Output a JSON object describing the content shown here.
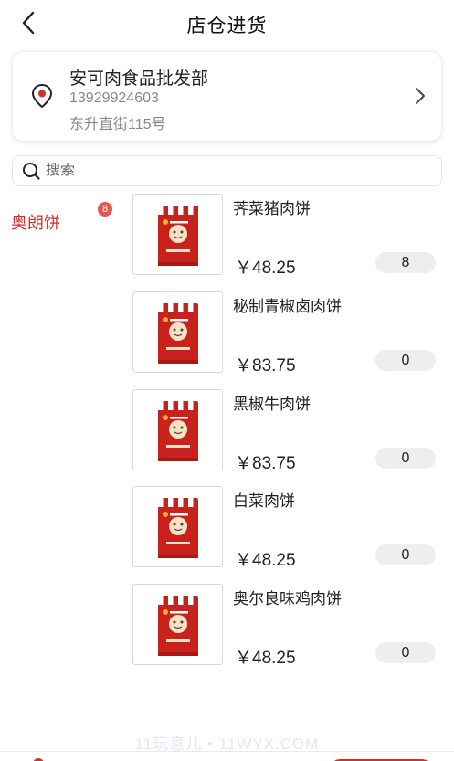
{
  "header": {
    "title": "店仓进货"
  },
  "store": {
    "name": "安可肉食品批发部",
    "phone": "13929924603",
    "address": "东升直街115号"
  },
  "search": {
    "placeholder": "搜索"
  },
  "categories": [
    {
      "label": "奥朗饼",
      "badge": "8",
      "selected": true
    }
  ],
  "products": [
    {
      "name": "荠菜猪肉饼",
      "price": "￥48.25",
      "qty": "8"
    },
    {
      "name": "秘制青椒卤肉饼",
      "price": "￥83.75",
      "qty": "0"
    },
    {
      "name": "黑椒牛肉饼",
      "price": "￥83.75",
      "qty": "0"
    },
    {
      "name": "白菜肉饼",
      "price": "￥48.25",
      "qty": "0"
    },
    {
      "name": "奥尔良味鸡肉饼",
      "price": "￥48.25",
      "qty": "0"
    }
  ],
  "watermark": "11玩意儿 • 11WYX.COM",
  "colors": {
    "accent": "#d0322a",
    "badge": "#e0594f",
    "muted_text": "#888888"
  },
  "icons": [
    "back-arrow-icon",
    "location-pin-icon",
    "chevron-right-icon",
    "search-icon",
    "product-package-image"
  ]
}
